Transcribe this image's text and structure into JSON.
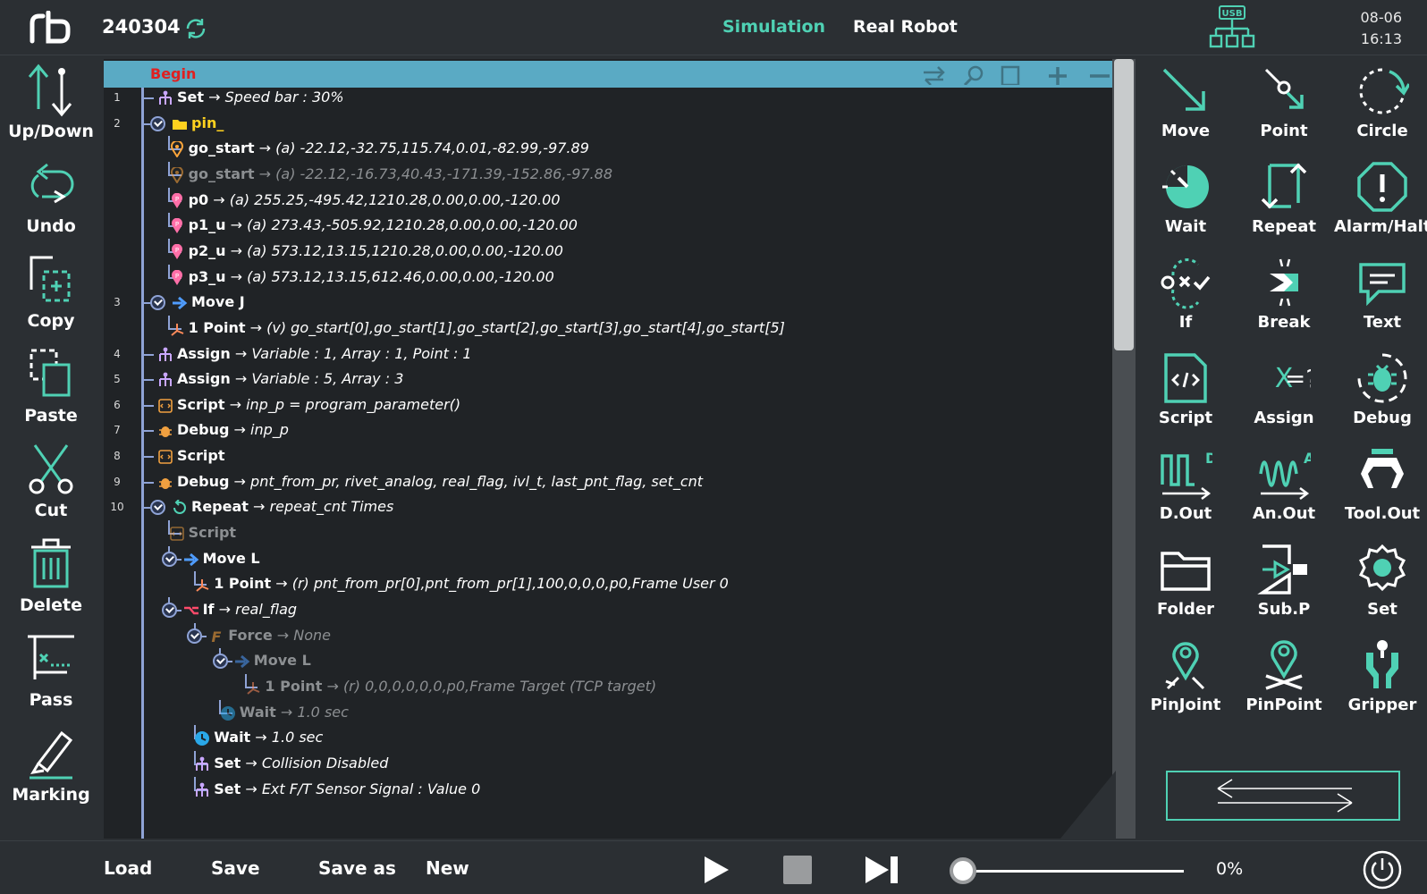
{
  "header": {
    "project": "240304",
    "mode_simulation": "Simulation",
    "mode_real": "Real Robot",
    "usb_label": "USB",
    "date": "08-06",
    "time": "16:13"
  },
  "left_tools": [
    {
      "label": "Up/Down",
      "icon": "up-down-icon"
    },
    {
      "label": "Undo",
      "icon": "undo-icon"
    },
    {
      "label": "Copy",
      "icon": "copy-icon"
    },
    {
      "label": "Paste",
      "icon": "paste-icon"
    },
    {
      "label": "Cut",
      "icon": "scissors-icon"
    },
    {
      "label": "Delete",
      "icon": "trash-icon"
    },
    {
      "label": "Pass",
      "icon": "pass-icon"
    },
    {
      "label": "Marking",
      "icon": "marker-icon"
    }
  ],
  "program": {
    "begin": "Begin",
    "rows": [
      {
        "num": "1",
        "name": "Set",
        "detail": "Speed bar : 30%"
      },
      {
        "num": "2",
        "name": "pin_",
        "detail": ""
      },
      {
        "num": "",
        "name": "go_start",
        "detail": "(a) -22.12,-32.75,115.74,0.01,-82.99,-97.89"
      },
      {
        "num": "",
        "name": "go_start",
        "detail": "(a) -22.12,-16.73,40.43,-171.39,-152.86,-97.88"
      },
      {
        "num": "",
        "name": "p0",
        "detail": "(a) 255.25,-495.42,1210.28,0.00,0.00,-120.00"
      },
      {
        "num": "",
        "name": "p1_u",
        "detail": "(a) 273.43,-505.92,1210.28,0.00,0.00,-120.00"
      },
      {
        "num": "",
        "name": "p2_u",
        "detail": "(a) 573.12,13.15,1210.28,0.00,0.00,-120.00"
      },
      {
        "num": "",
        "name": "p3_u",
        "detail": "(a) 573.12,13.15,612.46,0.00,0.00,-120.00"
      },
      {
        "num": "3",
        "name": "Move J",
        "detail": ""
      },
      {
        "num": "",
        "name": "1 Point",
        "detail": "(v) go_start[0],go_start[1],go_start[2],go_start[3],go_start[4],go_start[5]"
      },
      {
        "num": "4",
        "name": "Assign",
        "detail": "Variable : 1, Array : 1, Point : 1"
      },
      {
        "num": "5",
        "name": "Assign",
        "detail": "Variable : 5, Array : 3"
      },
      {
        "num": "6",
        "name": "Script",
        "detail": "inp_p = program_parameter()"
      },
      {
        "num": "7",
        "name": "Debug",
        "detail": "inp_p"
      },
      {
        "num": "8",
        "name": "Script",
        "detail": ""
      },
      {
        "num": "9",
        "name": "Debug",
        "detail": "pnt_from_pr, rivet_analog, real_flag, ivl_t, last_pnt_flag, set_cnt"
      },
      {
        "num": "10",
        "name": "Repeat",
        "detail": "repeat_cnt Times"
      },
      {
        "num": "",
        "name": "Script",
        "detail": ""
      },
      {
        "num": "",
        "name": "Move L",
        "detail": ""
      },
      {
        "num": "",
        "name": "1 Point",
        "detail": "(r) pnt_from_pr[0],pnt_from_pr[1],100,0,0,0,p0,Frame User 0"
      },
      {
        "num": "",
        "name": "If",
        "detail": "real_flag"
      },
      {
        "num": "",
        "name": "Force",
        "detail": "None"
      },
      {
        "num": "",
        "name": "Move L",
        "detail": ""
      },
      {
        "num": "",
        "name": "1 Point",
        "detail": "(r) 0,0,0,0,0,0,p0,Frame Target (TCP target)"
      },
      {
        "num": "",
        "name": "Wait",
        "detail": "1.0 sec"
      },
      {
        "num": "",
        "name": "Wait",
        "detail": "1.0 sec"
      },
      {
        "num": "",
        "name": "Set",
        "detail": "Collision Disabled"
      },
      {
        "num": "",
        "name": "Set",
        "detail": "Ext F/T Sensor Signal : Value 0"
      }
    ]
  },
  "palette": [
    {
      "label": "Move",
      "icon": "move-icon"
    },
    {
      "label": "Point",
      "icon": "point-icon"
    },
    {
      "label": "Circle",
      "icon": "circle-icon"
    },
    {
      "label": "Wait",
      "icon": "wait-icon"
    },
    {
      "label": "Repeat",
      "icon": "repeat-icon"
    },
    {
      "label": "Alarm/Halt",
      "icon": "alarm-icon"
    },
    {
      "label": "If",
      "icon": "if-icon"
    },
    {
      "label": "Break",
      "icon": "break-icon"
    },
    {
      "label": "Text",
      "icon": "text-icon"
    },
    {
      "label": "Script",
      "icon": "script-icon"
    },
    {
      "label": "Assign",
      "icon": "assign-icon"
    },
    {
      "label": "Debug",
      "icon": "debug-icon"
    },
    {
      "label": "D.Out",
      "icon": "digital-out-icon"
    },
    {
      "label": "An.Out",
      "icon": "analog-out-icon"
    },
    {
      "label": "Tool.Out",
      "icon": "tool-out-icon"
    },
    {
      "label": "Folder",
      "icon": "folder-icon"
    },
    {
      "label": "Sub.P",
      "icon": "sub-program-icon"
    },
    {
      "label": "Set",
      "icon": "set-gear-icon"
    },
    {
      "label": "PinJoint",
      "icon": "pin-joint-icon"
    },
    {
      "label": "PinPoint",
      "icon": "pin-point-icon"
    },
    {
      "label": "Gripper",
      "icon": "gripper-icon"
    }
  ],
  "footer": {
    "load": "Load",
    "save": "Save",
    "save_as": "Save as",
    "new": "New",
    "speed_value": 0,
    "speed_pct": "0%"
  },
  "colors": {
    "accent": "#4fd1b4",
    "background": "#2b2f33",
    "editor_bg": "#202326",
    "begin_bar": "#5aaac4",
    "begin_text": "#e02020",
    "tree_line": "#8fa3d6"
  }
}
